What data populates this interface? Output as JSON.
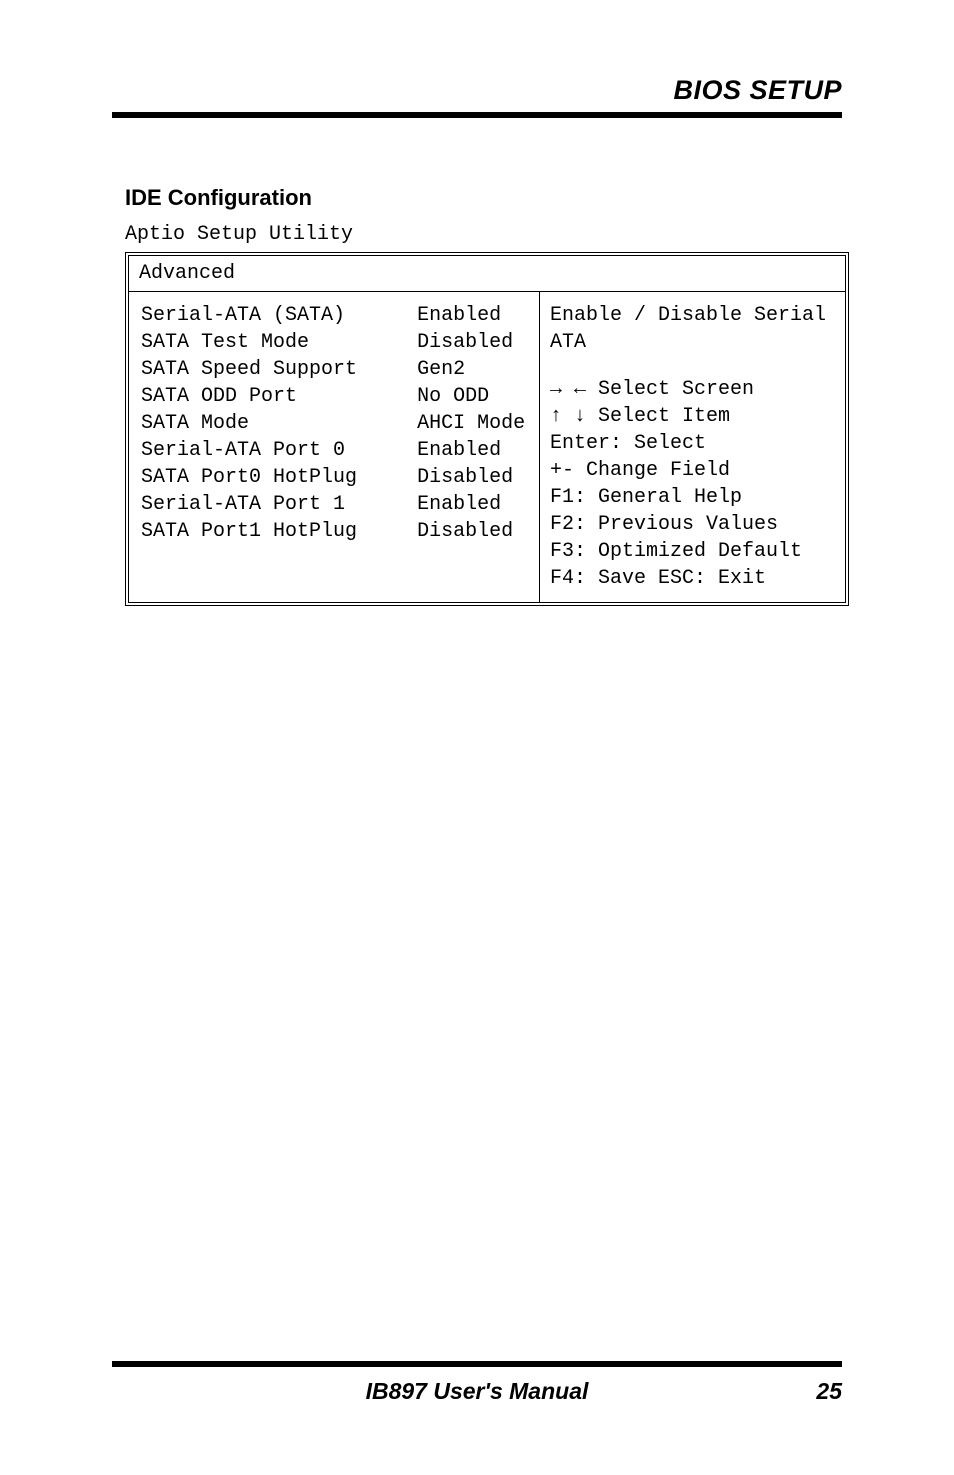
{
  "header": {
    "title": "BIOS SETUP"
  },
  "section": {
    "title": "IDE Configuration"
  },
  "bios": {
    "setup_name": "Aptio Setup Utility",
    "tab": "Advanced",
    "left": {
      "items": [
        {
          "label": "Serial-ATA (SATA)",
          "value": "Enabled"
        },
        {
          "label": "SATA Test Mode",
          "value": "Disabled"
        },
        {
          "label": "SATA Speed Support",
          "value": "Gen2"
        },
        {
          "label": "SATA ODD Port",
          "value": "No ODD"
        },
        {
          "label": "SATA Mode",
          "value": "AHCI Mode"
        },
        {
          "label": "Serial-ATA Port 0",
          "value": "Enabled"
        },
        {
          "label": "SATA Port0 HotPlug",
          "value": "Disabled"
        },
        {
          "label": "Serial-ATA Port 1",
          "value": "Enabled"
        },
        {
          "label": "SATA Port1 HotPlug",
          "value": "Disabled"
        }
      ]
    },
    "right": {
      "hint": "Enable / Disable Serial ATA",
      "help": [
        "→ ← Select Screen",
        "↑ ↓ Select Item",
        "Enter: Select",
        "+-  Change Field",
        "F1: General Help",
        "F2: Previous Values",
        "F3: Optimized Default",
        "F4: Save  ESC: Exit"
      ]
    }
  },
  "footer": {
    "manual": "IB897 User's Manual",
    "page": "25"
  }
}
